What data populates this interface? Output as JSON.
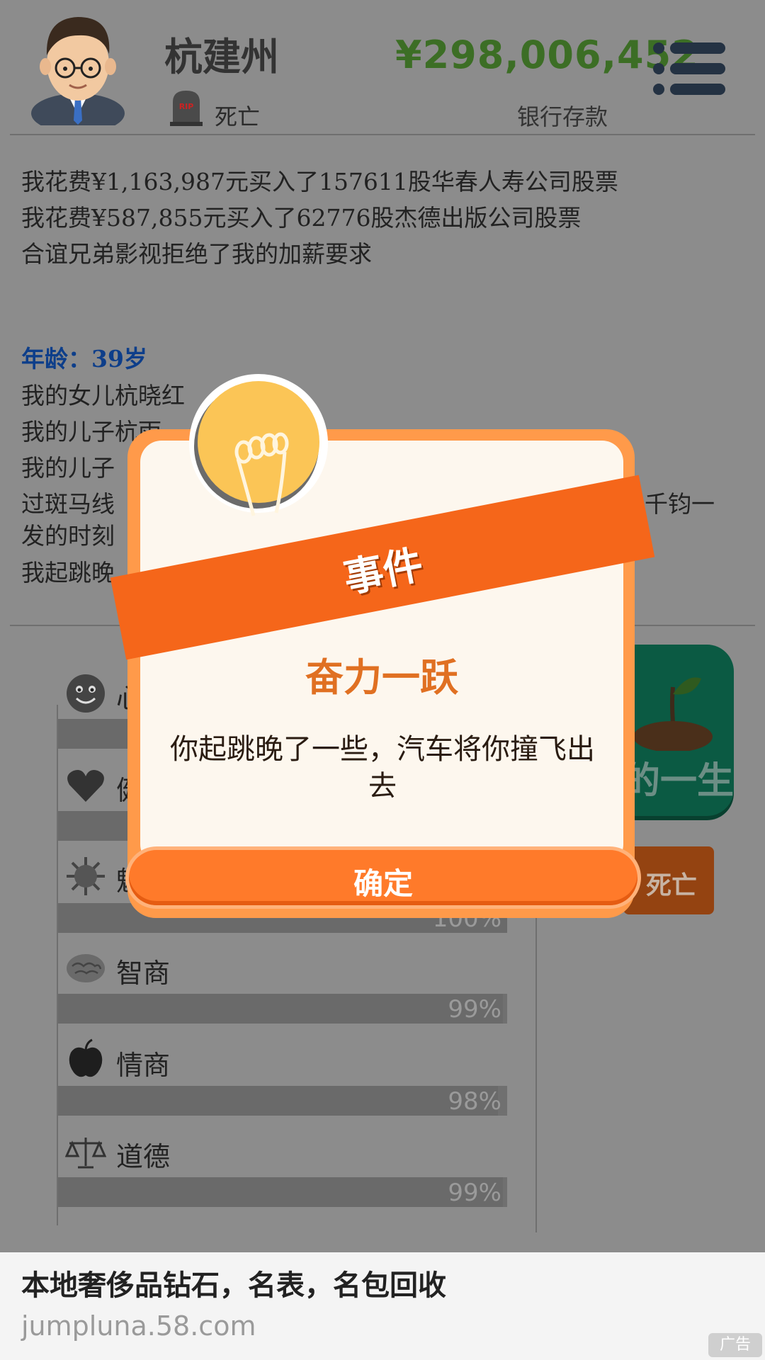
{
  "header": {
    "name": "杭建州",
    "status": "死亡",
    "money": "¥298,006,452",
    "money_label": "银行存款"
  },
  "log": {
    "lines": [
      "我花费¥1,163,987元买入了157611股华春人寿公司股票",
      "我花费¥587,855元买入了62776股杰德出版公司股票",
      "合谊兄弟影视拒绝了我的加薪要求",
      "年龄：39岁",
      "我的女儿杭晓红",
      "我的儿子杭雨",
      "我的儿子",
      "过斑马线",
      "千钧一",
      "发的时刻",
      "我起跳晚"
    ]
  },
  "stats": [
    {
      "label": "心",
      "icon": "smiley-face-icon",
      "value": 100,
      "pct_text": ""
    },
    {
      "label": "健",
      "icon": "heart-icon",
      "value": 100,
      "pct_text": ""
    },
    {
      "label": "魅",
      "icon": "sun-icon",
      "value": 100,
      "pct_text": "100%"
    },
    {
      "label": "智商",
      "icon": "brain-icon",
      "value": 99,
      "pct_text": "99%"
    },
    {
      "label": "情商",
      "icon": "apple-icon",
      "value": 98,
      "pct_text": "98%"
    },
    {
      "label": "道德",
      "icon": "scales-icon",
      "value": 99,
      "pct_text": "99%"
    }
  ],
  "buttons": {
    "life_label": "的一生",
    "death_label": "死亡"
  },
  "dialog": {
    "ribbon": "事件",
    "title": "奋力一跃",
    "description": "你起跳晚了一些，汽车将你撞飞出去",
    "confirm": "确定"
  },
  "ad": {
    "title": "本地奢侈品钻石，名表，名包回收",
    "url": "jumpluna.58.com",
    "badge": "广告"
  }
}
